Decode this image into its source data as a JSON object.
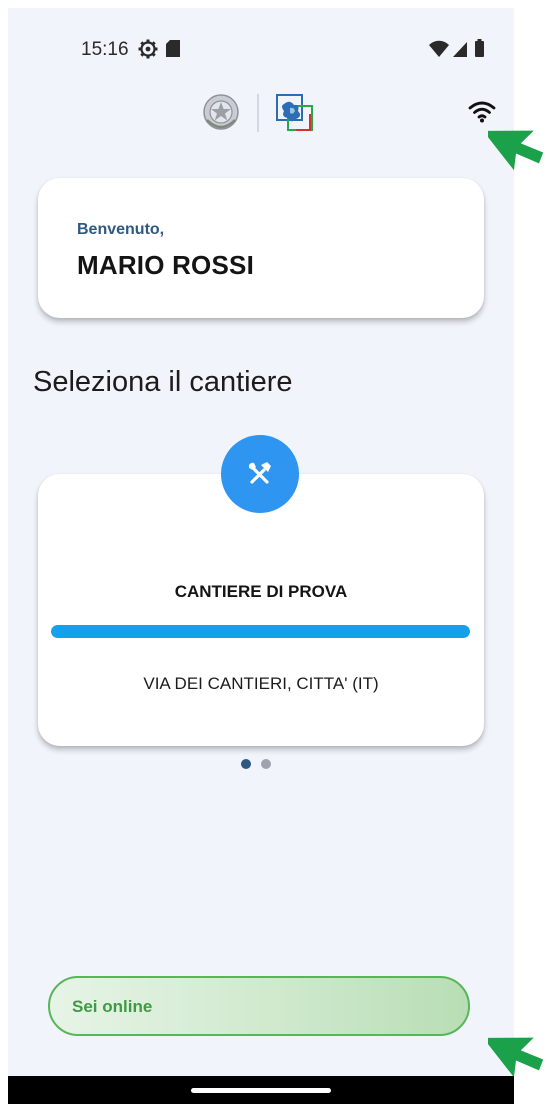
{
  "status_bar": {
    "time": "15:16",
    "left_icons": [
      "gear-icon",
      "sd-card-icon"
    ],
    "right_icons": [
      "wifi-signal-icon",
      "cell-signal-icon",
      "battery-icon"
    ]
  },
  "header": {
    "emblem_icon": "italian-republic-emblem",
    "logo_icon": "app-logo",
    "connection_icon": "wifi-icon"
  },
  "welcome": {
    "greeting": "Benvenuto,",
    "name": "MARIO ROSSI"
  },
  "section": {
    "title": "Seleziona il cantiere"
  },
  "site_card": {
    "icon": "tools-icon",
    "name": "CANTIERE DI PROVA",
    "progress_fraction": 1.0,
    "address": "VIA DEI CANTIERI, CITTA' (IT)"
  },
  "pager": {
    "total": 2,
    "active_index": 0
  },
  "connection_status": {
    "label": "Sei online"
  },
  "colors": {
    "background": "#f2f4fc",
    "accent_blue": "#2e95f0",
    "progress_blue": "#13a2ea",
    "greeting_blue": "#2f5883",
    "online_green": "#58b65a",
    "pointer_green": "#1aa14a"
  }
}
